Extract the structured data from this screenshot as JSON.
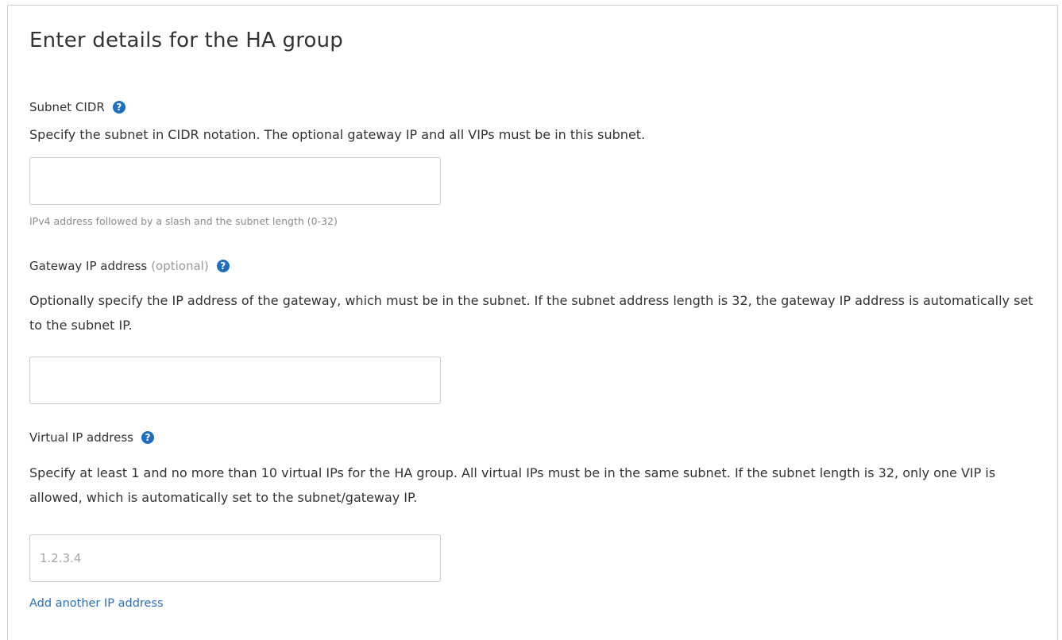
{
  "form": {
    "title": "Enter details for the HA group",
    "subnet_cidr": {
      "label": "Subnet CIDR",
      "help_icon": "question-circle-icon",
      "description": "Specify the subnet in CIDR notation. The optional gateway IP and all VIPs must be in this subnet.",
      "value": "",
      "placeholder": "",
      "hint": "IPv4 address followed by a slash and the subnet length (0-32)"
    },
    "gateway_ip": {
      "label": "Gateway IP address",
      "optional_text": "(optional)",
      "help_icon": "question-circle-icon",
      "description": "Optionally specify the IP address of the gateway, which must be in the subnet. If the subnet address length is 32, the gateway IP address is automatically set to the subnet IP.",
      "value": "",
      "placeholder": ""
    },
    "virtual_ip": {
      "label": "Virtual IP address",
      "help_icon": "question-circle-icon",
      "description": "Specify at least 1 and no more than 10 virtual IPs for the HA group. All virtual IPs must be in the same subnet. If the subnet length is 32, only one VIP is allowed, which is automatically set to the subnet/gateway IP.",
      "value": "",
      "placeholder": "1.2.3.4"
    },
    "add_ip_link": "Add another IP address"
  },
  "colors": {
    "help_icon": "#1f6ec1",
    "link": "#2a6ebb",
    "border": "#cccccc"
  }
}
